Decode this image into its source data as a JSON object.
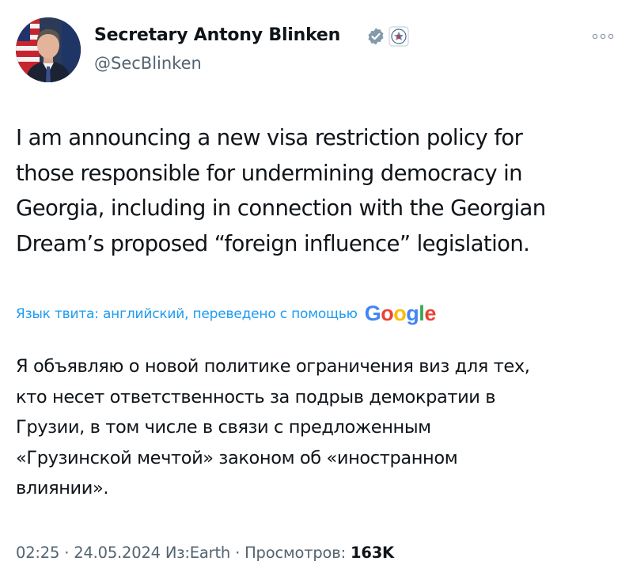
{
  "author": {
    "display_name": "Secretary Antony Blinken",
    "handle": "@SecBlinken",
    "avatar_icon": "profile-photo-avatar",
    "verified_icon": "gray-verified-checkmark-icon",
    "affiliation_icon": "state-department-seal-icon"
  },
  "more_icon": "more-dots-icon",
  "tweet": {
    "text": "I am announcing a new visa restriction policy for\nthose responsible for undermining democracy in\nGeorgia, including in connection with the Georgian\nDream’s proposed “foreign influence” legislation."
  },
  "translation": {
    "label": "Язык твита: английский, переведено с помощью",
    "provider": [
      "G",
      "o",
      "o",
      "g",
      "l",
      "e"
    ],
    "provider_colors": [
      "#4285f4",
      "#ea4335",
      "#fbbc05",
      "#4285f4",
      "#34a853",
      "#ea4335"
    ],
    "text": "Я объявляю о новой политике ограничения виз для тех,\nкто несет ответственность за подрыв демократии в\nГрузии, в том числе в связи с предложенным\n«Грузинской мечтой» законом об «иностранном\nвлиянии»."
  },
  "meta": {
    "time": "02:25",
    "date": "24.05.2024",
    "source": "Из:Earth",
    "views_label": "Просмотров:",
    "views_count": "163K",
    "separator": " · "
  },
  "colors": {
    "text_primary": "#0f1419",
    "text_secondary": "#536471",
    "link": "#1d9bf0",
    "verified_gray": "#829aab"
  }
}
